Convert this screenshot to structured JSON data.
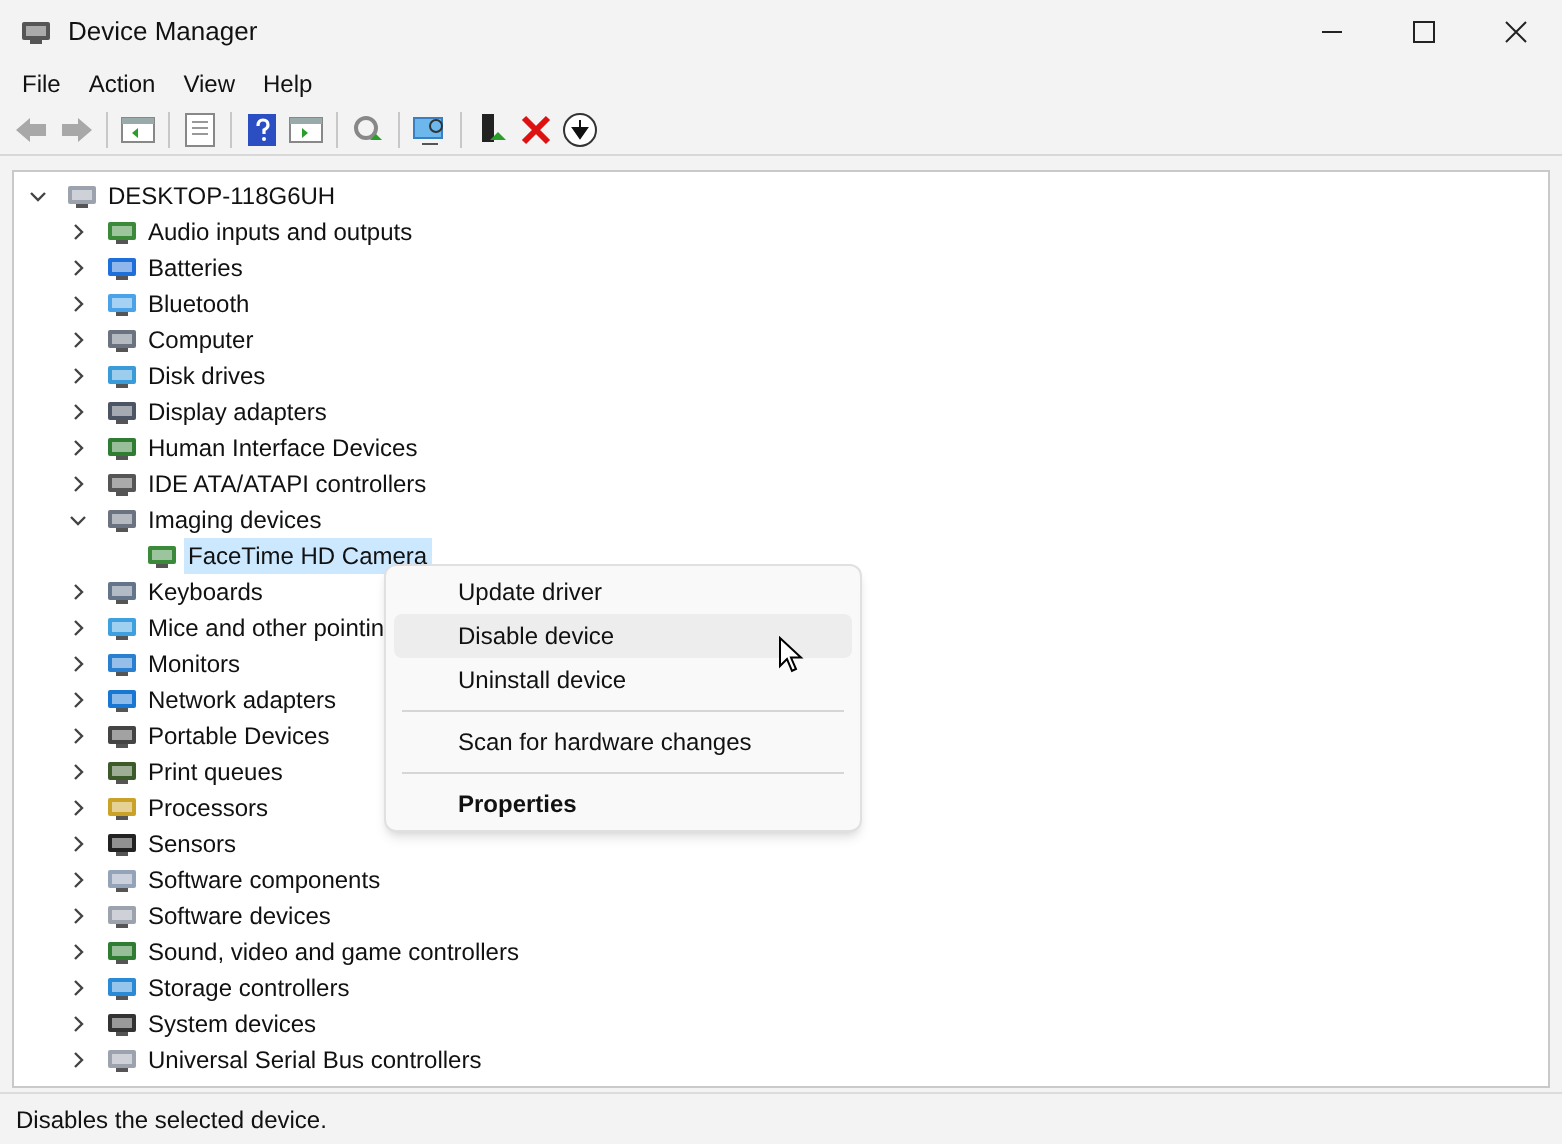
{
  "window": {
    "title": "Device Manager"
  },
  "menu_bar": [
    "File",
    "Action",
    "View",
    "Help"
  ],
  "tree": {
    "label": "DESKTOP-118G6UH",
    "expanded": true,
    "children": [
      {
        "label": "Audio inputs and outputs",
        "expanded": false
      },
      {
        "label": "Batteries",
        "expanded": false
      },
      {
        "label": "Bluetooth",
        "expanded": false
      },
      {
        "label": "Computer",
        "expanded": false
      },
      {
        "label": "Disk drives",
        "expanded": false
      },
      {
        "label": "Display adapters",
        "expanded": false
      },
      {
        "label": "Human Interface Devices",
        "expanded": false
      },
      {
        "label": "IDE ATA/ATAPI controllers",
        "expanded": false
      },
      {
        "label": "Imaging devices",
        "expanded": true,
        "children": [
          {
            "label": "FaceTime HD Camera",
            "selected": true
          }
        ]
      },
      {
        "label": "Keyboards",
        "expanded": false
      },
      {
        "label": "Mice and other pointin",
        "expanded": false
      },
      {
        "label": "Monitors",
        "expanded": false
      },
      {
        "label": "Network adapters",
        "expanded": false
      },
      {
        "label": "Portable Devices",
        "expanded": false
      },
      {
        "label": "Print queues",
        "expanded": false
      },
      {
        "label": "Processors",
        "expanded": false
      },
      {
        "label": "Sensors",
        "expanded": false
      },
      {
        "label": "Software components",
        "expanded": false
      },
      {
        "label": "Software devices",
        "expanded": false
      },
      {
        "label": "Sound, video and game controllers",
        "expanded": false
      },
      {
        "label": "Storage controllers",
        "expanded": false
      },
      {
        "label": "System devices",
        "expanded": false
      },
      {
        "label": "Universal Serial Bus controllers",
        "expanded": false
      }
    ]
  },
  "context_menu": [
    {
      "kind": "item",
      "label": "Update driver",
      "selected": false,
      "default": false
    },
    {
      "kind": "item",
      "label": "Disable device",
      "selected": true,
      "default": false
    },
    {
      "kind": "item",
      "label": "Uninstall device",
      "selected": false,
      "default": false
    },
    {
      "kind": "separator"
    },
    {
      "kind": "item",
      "label": "Scan for hardware changes",
      "selected": false,
      "default": false
    },
    {
      "kind": "separator"
    },
    {
      "kind": "item",
      "label": "Properties",
      "selected": false,
      "default": true
    }
  ],
  "status_bar": "Disables the selected device."
}
